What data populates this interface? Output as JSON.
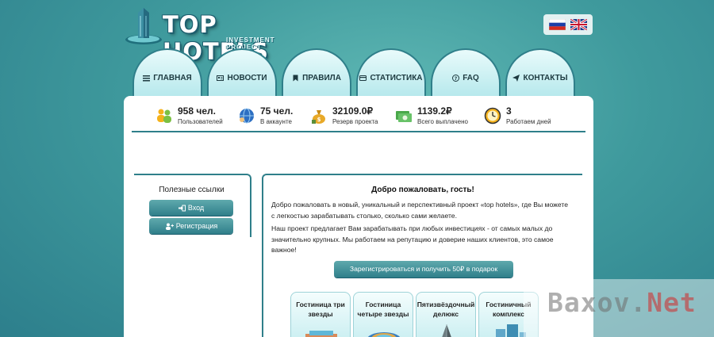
{
  "logo": {
    "title": "TOP HOTELS",
    "subtitle": "INVESTMENT PROJECT"
  },
  "languages": [
    {
      "name": "russian-flag"
    },
    {
      "name": "english-flag"
    }
  ],
  "nav": [
    {
      "label": "ГЛАВНАЯ",
      "icon": "menu-icon"
    },
    {
      "label": "НОВОСТИ",
      "icon": "newspaper-icon"
    },
    {
      "label": "ПРАВИЛА",
      "icon": "bookmark-icon"
    },
    {
      "label": "СТАТИСТИКА",
      "icon": "card-icon"
    },
    {
      "label": "FAQ",
      "icon": "question-icon"
    },
    {
      "label": "КОНТАКТЫ",
      "icon": "send-icon"
    }
  ],
  "stats": [
    {
      "value": "958 чел.",
      "label": "Пользователей",
      "icon": "users-icon"
    },
    {
      "value": "75 чел.",
      "label": "В аккаунте",
      "icon": "globe-users-icon"
    },
    {
      "value": "32109.0₽",
      "label": "Резерв проекта",
      "icon": "money-bag-icon"
    },
    {
      "value": "1139.2₽",
      "label": "Всего выплачено",
      "icon": "cash-icon"
    },
    {
      "value": "3",
      "label": "Работаем дней",
      "icon": "clock-icon"
    }
  ],
  "sidebar": {
    "title": "Полезные ссылки",
    "login_label": "Вход",
    "register_label": "Регистрация"
  },
  "main": {
    "title": "Добро пожаловать, гость!",
    "paragraph1": "Добро пожаловать в новый, уникальный и перспективный проект «top hotels», где Вы можете с легкостью зарабатывать столько, сколько сами желаете.",
    "paragraph2": "Наш проект предлагает Вам зарабатывать при любых инвестициях - от самых малых до значительно крупных. Мы работаем на репутацию и доверие наших клиентов, это самое важное!",
    "register_button": "Зарегистрироваться и получить 50₽ в подарок"
  },
  "cards": [
    {
      "title": "Гостиница три звезды"
    },
    {
      "title": "Гостиница четыре звезды"
    },
    {
      "title": "Пятизвёздочный делюкс"
    },
    {
      "title": "Гостиничный комплекс"
    }
  ],
  "watermark": {
    "part1": "Baxov.",
    "part2": "Net"
  }
}
